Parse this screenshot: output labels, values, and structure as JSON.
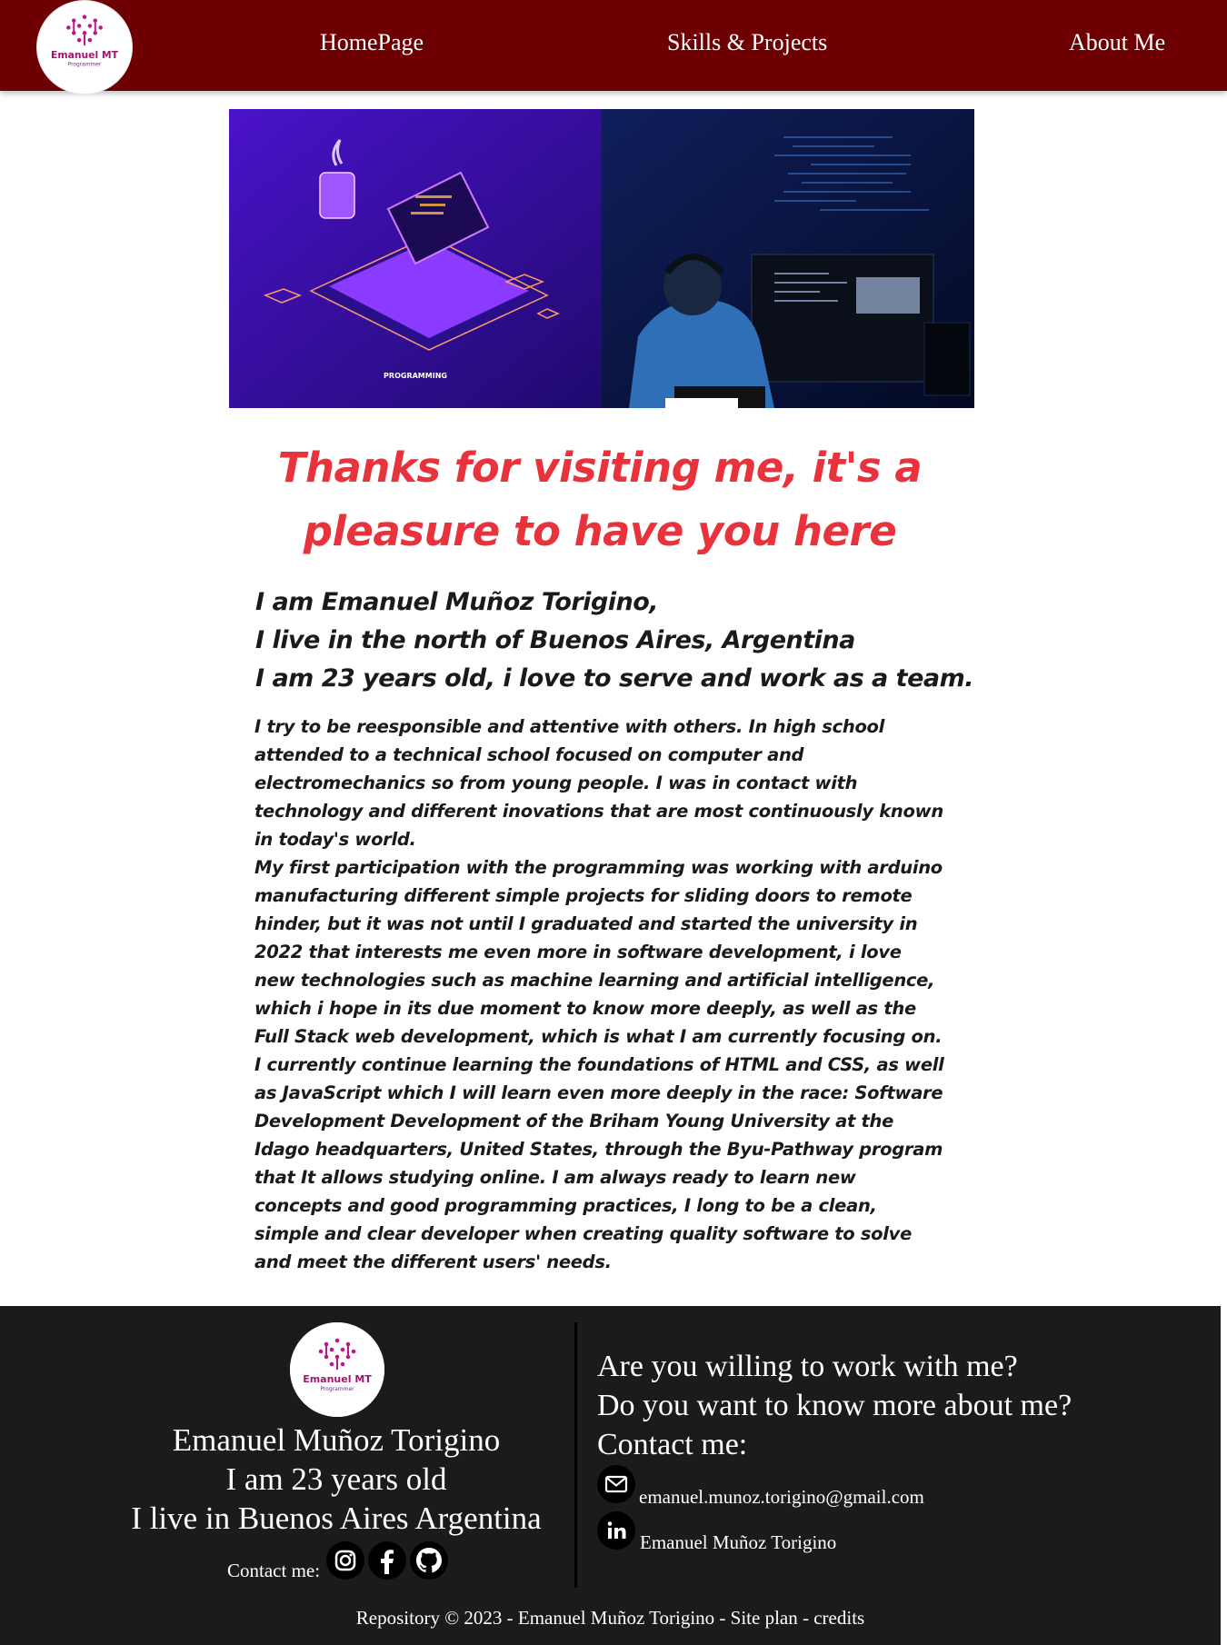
{
  "header": {
    "logo": {
      "name": "Emanuel MT",
      "tagline": "Programmer"
    },
    "nav": [
      "HomePage",
      "Skills & Projects",
      "About Me"
    ]
  },
  "hero": {
    "caption": "PROGRAMMING"
  },
  "main": {
    "headline_1": "Thanks for visiting me, it's a",
    "headline_2": "pleasure to have you here",
    "intro": [
      "I am Emanuel Muñoz Torigino,",
      "I live in the north of Buenos Aires, Argentina",
      "I am 23 years old, i love to serve and work as a team."
    ],
    "bio": [
      "I try to be reesponsible and attentive with others. In high school attended to a technical school focused on computer and electromechanics so from young people. I was in contact with technology and different inovations that are most continuously known in today's world.",
      "My first participation with the programming was working with arduino manufacturing different simple projects for sliding doors to remote hinder, but it was not until I graduated and started the university in 2022 that interests me even more in software development, i love new technologies such as machine learning and artificial intelligence, which i hope in its due moment to know more deeply, as well as the Full Stack web development, which is what I am currently focusing on.",
      "I currently continue learning the foundations of HTML and CSS, as well as JavaScript which I will learn even more deeply in the race: Software Development Development of the Briham Young University at the Idago headquarters, United States, through the Byu-Pathway program that It allows studying online. I am always ready to learn new concepts and good programming practices, I long to be a clean, simple and clear developer when creating quality software to solve and meet the different users' needs."
    ]
  },
  "footer": {
    "logo": {
      "name": "Emanuel MT",
      "tagline": "Programmer"
    },
    "name": "Emanuel Muñoz Torigino",
    "age": "I am 23 years old",
    "location": "I live in Buenos Aires Argentina",
    "contact_label": "Contact me:",
    "social_icons": [
      "instagram-icon",
      "facebook-icon",
      "github-icon"
    ],
    "question_1": "Are you willing to work with me?",
    "question_2": "Do you want to know more about me?",
    "contact_heading": "Contact me:",
    "email": "emanuel.munoz.torigino@gmail.com",
    "linkedin": "Emanuel Muñoz Torigino",
    "copyright": "Repository © 2023 - Emanuel Muñoz Torigino - Site plan - credits"
  },
  "colors": {
    "header_bg": "#6e0004",
    "headline": "#e8323c",
    "footer_bg": "#1b1b1b",
    "logo_accent": "#b0158a"
  }
}
